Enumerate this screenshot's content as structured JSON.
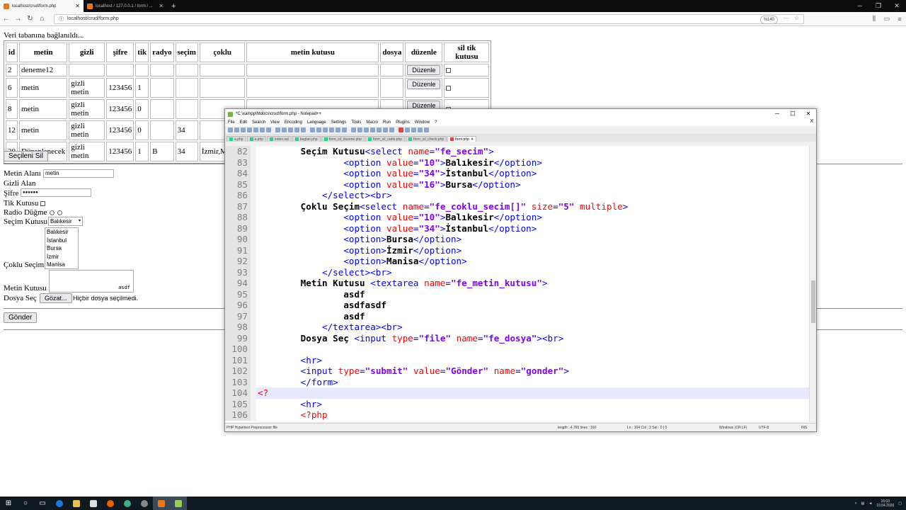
{
  "browser": {
    "tabs": [
      {
        "label": "localhost/crud/form.php",
        "active": true
      },
      {
        "label": "localhost / 127.0.0.1 / form / ...",
        "active": false
      }
    ],
    "new_tab": "+",
    "window_controls": [
      "─",
      "❐",
      "✕"
    ],
    "url": "localhost/crud/form.php",
    "zoom": "%140"
  },
  "page": {
    "db_message": "Veri tabanına bağlanıldı...",
    "table": {
      "headers": [
        "id",
        "metin",
        "gizli",
        "şifre",
        "tik",
        "radyo",
        "seçim",
        "çoklu",
        "metin kutusu",
        "dosya",
        "düzenle",
        "sil tik kutusu"
      ],
      "rows": [
        {
          "id": "2",
          "metin": "deneme12",
          "gizli": "",
          "sifre": "",
          "tik": "",
          "radyo": "",
          "secim": "",
          "coklu": "",
          "metin_kutusu": "",
          "dosya": "",
          "duzenle": "Düzenle"
        },
        {
          "id": "6",
          "metin": "metin",
          "gizli": "gizli metin",
          "sifre": "123456",
          "tik": "1",
          "radyo": "",
          "secim": "",
          "coklu": "",
          "metin_kutusu": "",
          "dosya": "",
          "duzenle": "Düzenle"
        },
        {
          "id": "8",
          "metin": "metin",
          "gizli": "gizli metin",
          "sifre": "123456",
          "tik": "0",
          "radyo": "",
          "secim": "",
          "coklu": "",
          "metin_kutusu": "",
          "dosya": "",
          "duzenle": "Düzenle"
        },
        {
          "id": "12",
          "metin": "metin",
          "gizli": "gizli metin",
          "sifre": "123456",
          "tik": "0",
          "radyo": "",
          "secim": "34",
          "coklu": "",
          "metin_kutusu": "",
          "dosya": "",
          "duzenle": ""
        },
        {
          "id": "20",
          "metin": "Düzenlenecek",
          "gizli": "gizli metin",
          "sifre": "123456",
          "tik": "1",
          "radyo": "B",
          "secim": "34",
          "coklu": "İzmir,Manisa",
          "metin_kutusu": "",
          "dosya": "",
          "duzenle": ""
        }
      ]
    },
    "delete_selected": "Seçileni Sil",
    "form": {
      "metin_label": "Metin Alanı",
      "metin_value": "metin",
      "gizli_label": "Gizli Alan",
      "sifre_label": "Şifre",
      "sifre_value": "●●●●●●",
      "tik_label": "Tik Kutusu",
      "radio_label": "Radio Düğme",
      "secim_label": "Seçim Kutusu",
      "secim_value": "Balıkesir",
      "coklu_label": "Çoklu Seçim",
      "coklu_options": [
        "Balıkesir",
        "İstanbul",
        "Bursa",
        "İzmir",
        "Manisa"
      ],
      "metin_kutusu_label": "Metin Kutusu",
      "metin_kutusu_value": "asdf",
      "dosya_label": "Dosya Seç",
      "dosya_button": "Gözat...",
      "dosya_status": "Hiçbir dosya seçilmedi.",
      "submit": "Gönder"
    }
  },
  "npp": {
    "title": "*C:\\xampp\\htdocs\\crud\\form.php - Notepad++",
    "menu": [
      "File",
      "Edit",
      "Search",
      "View",
      "Encoding",
      "Language",
      "Settings",
      "Tools",
      "Macro",
      "Run",
      "Plugins",
      "Window",
      "?"
    ],
    "menu_close": "X",
    "tabs": [
      {
        "label": "a.php",
        "active": false
      },
      {
        "label": "a.php",
        "active": false
      },
      {
        "label": "index.sql",
        "active": false
      },
      {
        "label": "baglan.php",
        "active": false
      },
      {
        "label": "form_sil_duzene.php",
        "active": false
      },
      {
        "label": "form_sil_radio.php",
        "active": false
      },
      {
        "label": "form_sil_check.php",
        "active": false
      },
      {
        "label": "form.php",
        "active": true
      }
    ],
    "status": {
      "filetype": "PHP Hypertext Preprocessor file",
      "length": "length : 4,765    lines : 160",
      "pos": "Ln : 104    Col : 3    Sel : 0 | 0",
      "eol": "Windows (CR LF)",
      "enc": "UTF-8",
      "ins": "INS"
    },
    "lines": [
      {
        "n": "82",
        "parts": [
          [
            "b",
            "        Seçim Kutusu"
          ],
          [
            "t",
            "<select "
          ],
          [
            "a",
            "name"
          ],
          [
            "t",
            "="
          ],
          [
            "s",
            "\"fe_secim\""
          ],
          [
            "t",
            ">"
          ]
        ]
      },
      {
        "n": "83",
        "parts": [
          [
            "t",
            "                <option "
          ],
          [
            "a",
            "value"
          ],
          [
            "t",
            "="
          ],
          [
            "s",
            "\"10\""
          ],
          [
            "t",
            ">"
          ],
          [
            "b",
            "Balıkesir"
          ],
          [
            "t",
            "</option>"
          ]
        ]
      },
      {
        "n": "84",
        "parts": [
          [
            "t",
            "                <option "
          ],
          [
            "a",
            "value"
          ],
          [
            "t",
            "="
          ],
          [
            "s",
            "\"34\""
          ],
          [
            "t",
            ">"
          ],
          [
            "b",
            "İstanbul"
          ],
          [
            "t",
            "</option>"
          ]
        ]
      },
      {
        "n": "85",
        "parts": [
          [
            "t",
            "                <option "
          ],
          [
            "a",
            "value"
          ],
          [
            "t",
            "="
          ],
          [
            "s",
            "\"16\""
          ],
          [
            "t",
            ">"
          ],
          [
            "b",
            "Bursa"
          ],
          [
            "t",
            "</option>"
          ]
        ]
      },
      {
        "n": "86",
        "parts": [
          [
            "t",
            "            </select><br>"
          ]
        ]
      },
      {
        "n": "87",
        "parts": [
          [
            "b",
            "        Çoklu Seçim"
          ],
          [
            "t",
            "<select "
          ],
          [
            "a",
            "name"
          ],
          [
            "t",
            "="
          ],
          [
            "s",
            "\"fe_coklu_secim[]\""
          ],
          [
            "t",
            " "
          ],
          [
            "a",
            "size"
          ],
          [
            "t",
            "="
          ],
          [
            "s",
            "\"5\""
          ],
          [
            "t",
            " "
          ],
          [
            "a",
            "multiple"
          ],
          [
            "t",
            ">"
          ]
        ]
      },
      {
        "n": "88",
        "parts": [
          [
            "t",
            "                <option "
          ],
          [
            "a",
            "value"
          ],
          [
            "t",
            "="
          ],
          [
            "s",
            "\"10\""
          ],
          [
            "t",
            ">"
          ],
          [
            "b",
            "Balıkesir"
          ],
          [
            "t",
            "</option>"
          ]
        ]
      },
      {
        "n": "89",
        "parts": [
          [
            "t",
            "                <option "
          ],
          [
            "a",
            "value"
          ],
          [
            "t",
            "="
          ],
          [
            "s",
            "\"34\""
          ],
          [
            "t",
            ">"
          ],
          [
            "b",
            "İstanbul"
          ],
          [
            "t",
            "</option>"
          ]
        ]
      },
      {
        "n": "90",
        "parts": [
          [
            "t",
            "                <option>"
          ],
          [
            "b",
            "Bursa"
          ],
          [
            "t",
            "</option>"
          ]
        ]
      },
      {
        "n": "91",
        "parts": [
          [
            "t",
            "                <option>"
          ],
          [
            "b",
            "İzmir"
          ],
          [
            "t",
            "</option>"
          ]
        ]
      },
      {
        "n": "92",
        "parts": [
          [
            "t",
            "                <option>"
          ],
          [
            "b",
            "Manisa"
          ],
          [
            "t",
            "</option>"
          ]
        ]
      },
      {
        "n": "93",
        "parts": [
          [
            "t",
            "            </select><br>"
          ]
        ]
      },
      {
        "n": "94",
        "parts": [
          [
            "b",
            "        Metin Kutusu "
          ],
          [
            "t",
            "<textarea "
          ],
          [
            "a",
            "name"
          ],
          [
            "t",
            "="
          ],
          [
            "s",
            "\"fe_metin_kutusu\""
          ],
          [
            "t",
            ">"
          ]
        ]
      },
      {
        "n": "95",
        "parts": [
          [
            "b",
            "                asdf"
          ]
        ]
      },
      {
        "n": "96",
        "parts": [
          [
            "b",
            "                asdfasdf"
          ]
        ]
      },
      {
        "n": "97",
        "parts": [
          [
            "b",
            "                asdf"
          ]
        ]
      },
      {
        "n": "98",
        "parts": [
          [
            "t",
            "            </textarea><br>"
          ]
        ]
      },
      {
        "n": "99",
        "parts": [
          [
            "b",
            "        Dosya Seç "
          ],
          [
            "t",
            "<input "
          ],
          [
            "a",
            "type"
          ],
          [
            "t",
            "="
          ],
          [
            "s",
            "\"file\""
          ],
          [
            "t",
            " "
          ],
          [
            "a",
            "name"
          ],
          [
            "t",
            "="
          ],
          [
            "s",
            "\"fe_dosya\""
          ],
          [
            "t",
            "><br>"
          ]
        ]
      },
      {
        "n": "100",
        "parts": [
          [
            "b",
            ""
          ]
        ]
      },
      {
        "n": "101",
        "parts": [
          [
            "t",
            "        <hr>"
          ]
        ]
      },
      {
        "n": "102",
        "parts": [
          [
            "t",
            "        <input "
          ],
          [
            "a",
            "type"
          ],
          [
            "t",
            "="
          ],
          [
            "s",
            "\"submit\""
          ],
          [
            "t",
            " "
          ],
          [
            "a",
            "value"
          ],
          [
            "t",
            "="
          ],
          [
            "s",
            "\"Gönder\""
          ],
          [
            "t",
            " "
          ],
          [
            "a",
            "name"
          ],
          [
            "t",
            "="
          ],
          [
            "s",
            "\"gonder\""
          ],
          [
            "t",
            ">"
          ]
        ]
      },
      {
        "n": "103",
        "parts": [
          [
            "t",
            "        </form>"
          ]
        ]
      },
      {
        "n": "104",
        "parts": [
          [
            "p",
            "<?"
          ]
        ],
        "current": true
      },
      {
        "n": "105",
        "parts": [
          [
            "t",
            "        <hr>"
          ]
        ]
      },
      {
        "n": "106",
        "parts": [
          [
            "p",
            "        <?php"
          ]
        ]
      }
    ]
  },
  "taskbar": {
    "time": "16:03",
    "date": "19.04.2020"
  }
}
